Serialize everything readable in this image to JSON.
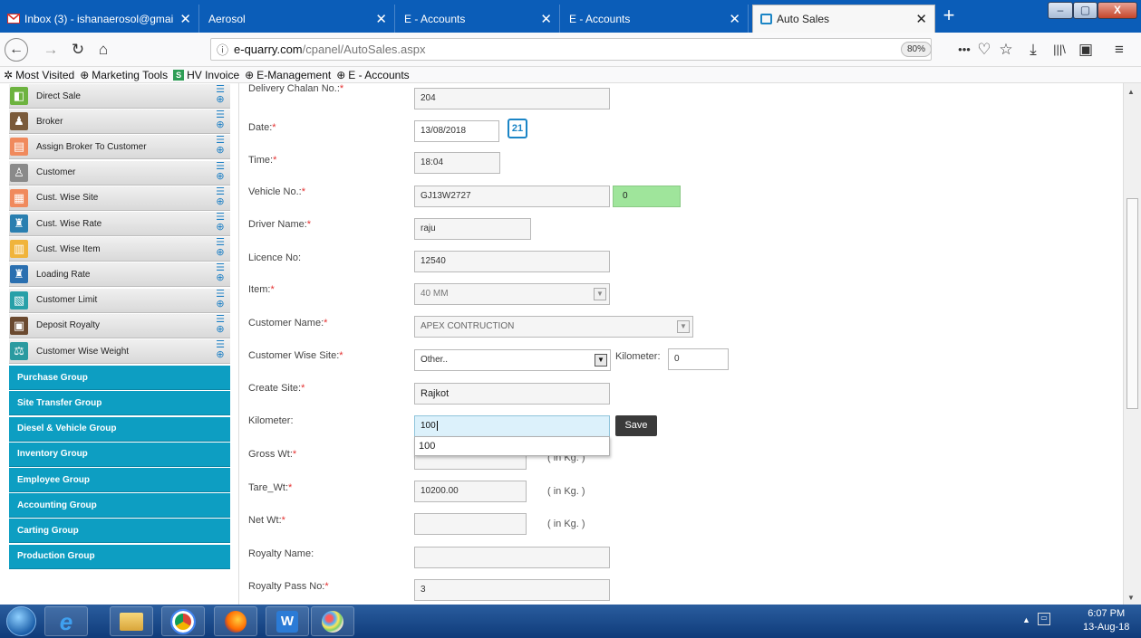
{
  "tabs": [
    {
      "title": "Inbox (3) - ishanaerosol@gmail",
      "favicon": "gmail-icon",
      "color": "#d93025"
    },
    {
      "title": "Aerosol",
      "favicon": "",
      "color": ""
    },
    {
      "title": "E - Accounts",
      "favicon": "",
      "color": ""
    },
    {
      "title": "E - Accounts",
      "favicon": "",
      "color": ""
    },
    {
      "title": "Auto Sales",
      "favicon": "page-icon",
      "color": "#1b85c6"
    }
  ],
  "toolbar": {
    "url_host": "e-quarry.com",
    "url_path": "/cpanel/AutoSales.aspx",
    "zoom": "80%"
  },
  "bookmarks": [
    {
      "label": "Most Visited",
      "icon": "gear-icon"
    },
    {
      "label": "Marketing Tools",
      "icon": "globe-icon"
    },
    {
      "label": "HV Invoice",
      "icon": "s-icon"
    },
    {
      "label": "E-Management",
      "icon": "globe-icon"
    },
    {
      "label": "E - Accounts",
      "icon": "globe-icon"
    }
  ],
  "sidebar": {
    "items": [
      {
        "label": "Direct Sale",
        "color": "#6db33f"
      },
      {
        "label": "Broker",
        "color": "#7a5a3a"
      },
      {
        "label": "Assign Broker To Customer",
        "color": "#f08a5d"
      },
      {
        "label": "Customer",
        "color": "#8a8a8a"
      },
      {
        "label": "Cust. Wise Site",
        "color": "#f08a5d"
      },
      {
        "label": "Cust. Wise Rate",
        "color": "#2a7fb0"
      },
      {
        "label": "Cust. Wise Item",
        "color": "#f0b43c"
      },
      {
        "label": "Loading Rate",
        "color": "#2a6fb0"
      },
      {
        "label": "Customer Limit",
        "color": "#28a0a8"
      },
      {
        "label": "Deposit Royalty",
        "color": "#6b4a30"
      },
      {
        "label": "Customer Wise Weight",
        "color": "#2a9aa0"
      }
    ],
    "groups": [
      "Purchase Group",
      "Site Transfer Group",
      "Diesel & Vehicle Group",
      "Inventory Group",
      "Employee Group",
      "Accounting Group",
      "Carting Group",
      "Production Group"
    ]
  },
  "form": {
    "delivery_chalan": {
      "label": "Delivery Chalan No.:",
      "value": "204"
    },
    "date": {
      "label": "Date:",
      "value": "13/08/2018",
      "calendar": "21"
    },
    "time": {
      "label": "Time:",
      "value": "18:04"
    },
    "vehicle": {
      "label": "Vehicle No.:",
      "value": "GJ13W2727",
      "status": "0"
    },
    "driver": {
      "label": "Driver Name:",
      "value": "raju"
    },
    "licence": {
      "label": "Licence No:",
      "value": "12540"
    },
    "item": {
      "label": "Item:",
      "value": "40 MM"
    },
    "customer_name": {
      "label": "Customer Name:",
      "value": "APEX CONTRUCTION"
    },
    "customer_site": {
      "label": "Customer Wise Site:",
      "value": "Other..",
      "km_label": "Kilometer:",
      "km_value": "0"
    },
    "create_site": {
      "label": "Create Site:",
      "value": "Rajkot"
    },
    "kilometer": {
      "label": "Kilometer:",
      "value": "100",
      "suggestion": "100",
      "save_label": "Save"
    },
    "gross_wt": {
      "label": "Gross Wt:",
      "value": "",
      "unit": "( in Kg. )"
    },
    "tare_wt": {
      "label": "Tare_Wt:",
      "value": "10200.00",
      "unit": "( in Kg. )"
    },
    "net_wt": {
      "label": "Net Wt:",
      "value": "",
      "unit": "( in Kg. )"
    },
    "royalty_name": {
      "label": "Royalty Name:",
      "value": ""
    },
    "royalty_pass": {
      "label": "Royalty Pass No:",
      "value": "3"
    }
  },
  "taskbar": {
    "time": "6:07 PM",
    "date": "13-Aug-18"
  }
}
